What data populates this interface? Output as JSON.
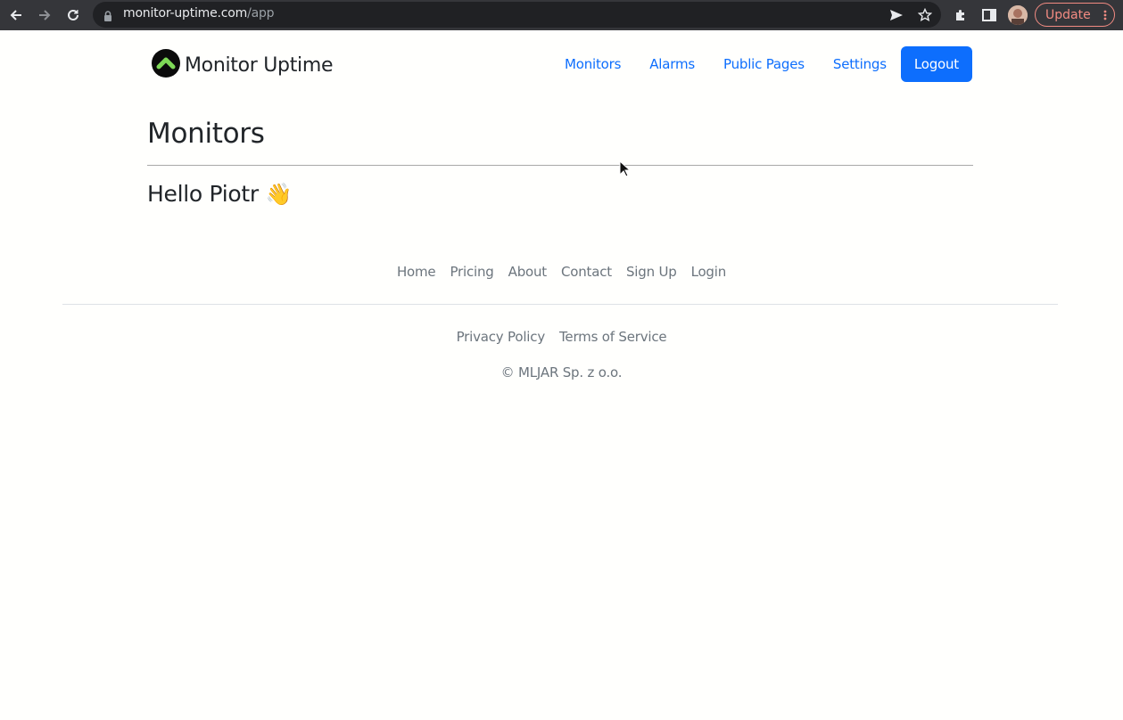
{
  "browser": {
    "url_host": "monitor-uptime.com",
    "url_path": "/app",
    "update_label": "Update",
    "icons": [
      "back-icon",
      "forward-icon",
      "reload-icon",
      "lock-icon",
      "share-icon",
      "star-icon",
      "extensions-icon",
      "side-panel-icon",
      "avatar",
      "menu-dots-icon"
    ]
  },
  "header": {
    "brand": "Monitor Uptime",
    "nav": [
      "Monitors",
      "Alarms",
      "Public Pages",
      "Settings"
    ],
    "logout_label": "Logout"
  },
  "main": {
    "title": "Monitors",
    "greeting": "Hello Piotr",
    "greeting_emoji": "👋"
  },
  "footer": {
    "links": [
      "Home",
      "Pricing",
      "About",
      "Contact",
      "Sign Up",
      "Login"
    ],
    "legal": [
      "Privacy Policy",
      "Terms of Service"
    ],
    "copyright": "© MLJAR Sp. z o.o."
  },
  "colors": {
    "accent": "#0d6efd",
    "muted": "#6c757d",
    "logo_green": "#7ed957",
    "chrome_bg": "#35363a"
  }
}
